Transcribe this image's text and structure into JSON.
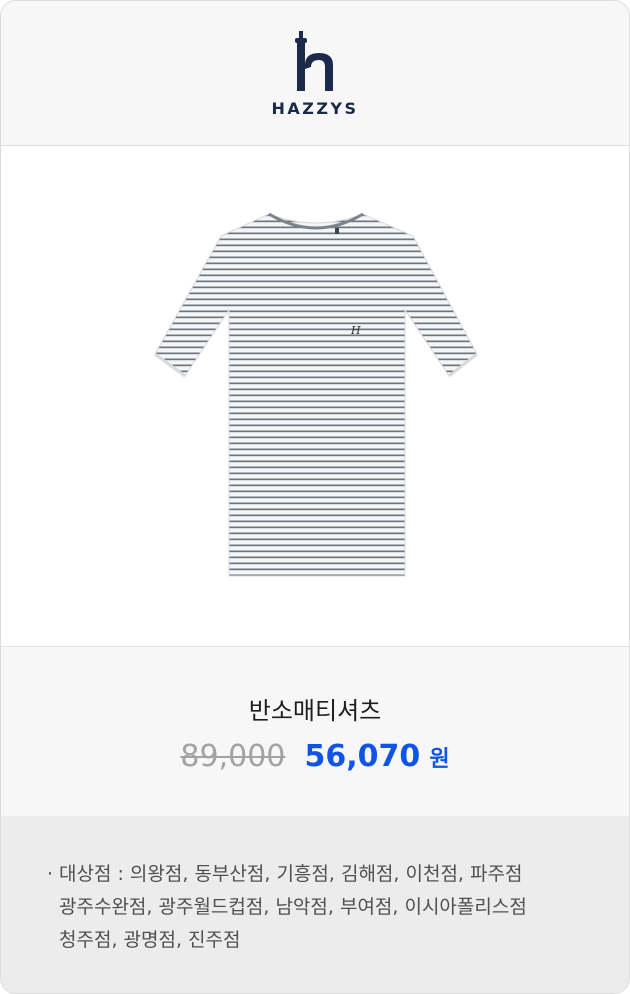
{
  "brand": {
    "name": "HAZZYS",
    "logo_icon": "hazzys-h-logo-icon"
  },
  "product": {
    "image_icon": "striped-tshirt-image",
    "name": "반소매티셔츠",
    "price_original": "89,000",
    "price_sale": "56,070",
    "currency": "원"
  },
  "stores": {
    "bullet": "·",
    "lines": [
      "대상점 : 의왕점, 동부산점, 기흥점, 김해점, 이천점, 파주점",
      "광주수완점, 광주월드컵점, 남악점, 부여점, 이시아폴리스점",
      "청주점, 광명점, 진주점"
    ]
  },
  "colors": {
    "brand_navy": "#1b2a4a",
    "sale_blue": "#1053e8",
    "strike_gray": "#a3a3a3"
  }
}
